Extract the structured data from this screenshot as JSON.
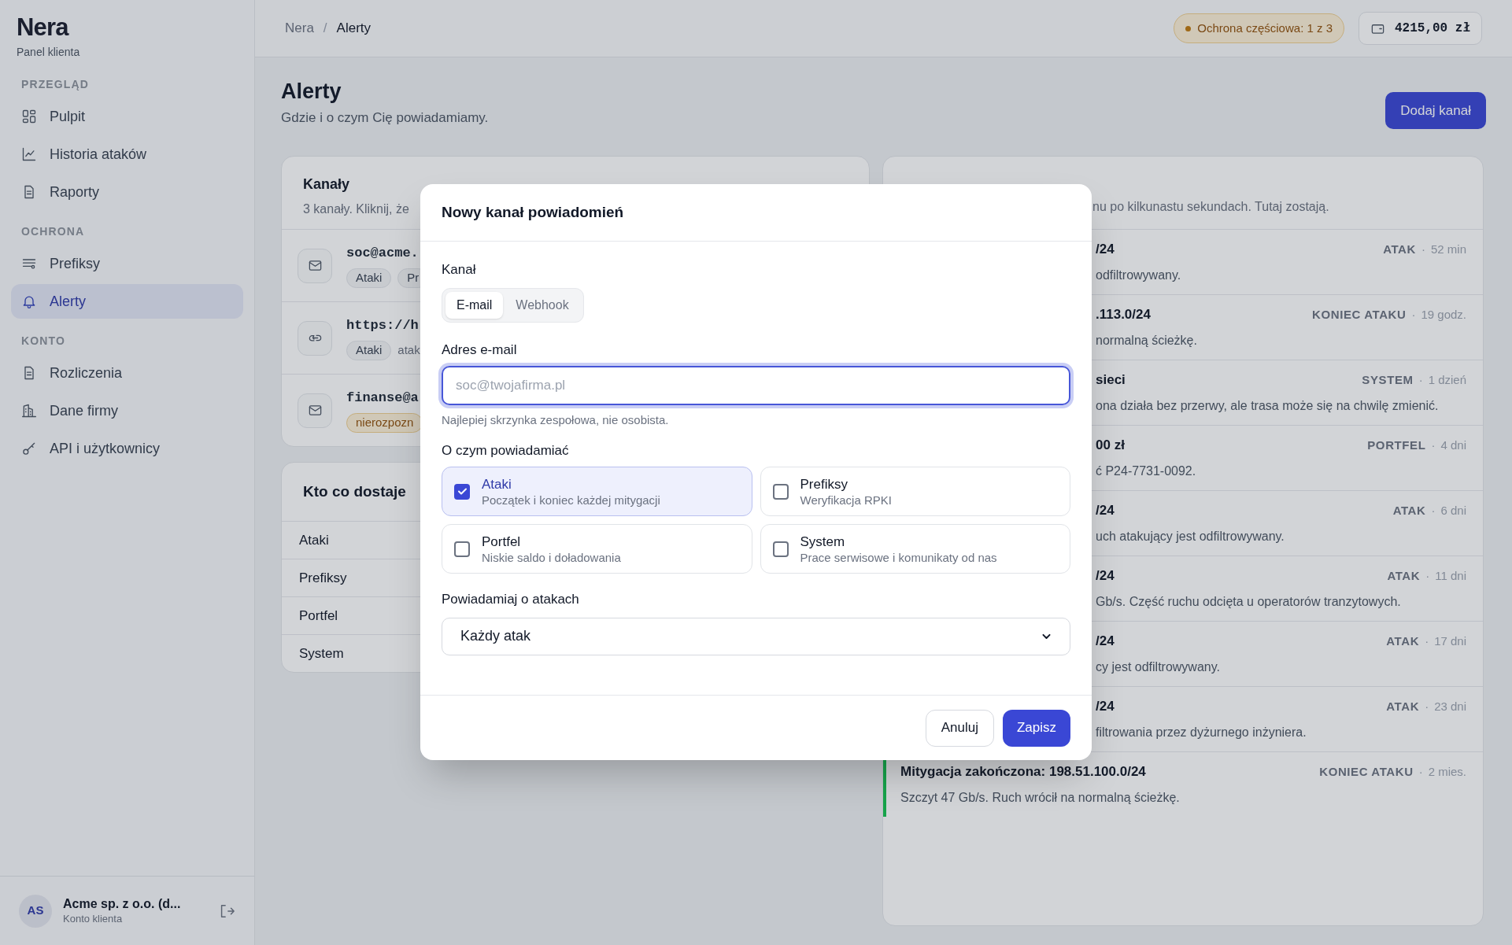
{
  "sidebar": {
    "logo": "Nera",
    "subtitle": "Panel klienta",
    "sections": [
      {
        "heading": "PRZEGLĄD",
        "items": [
          {
            "label": "Pulpit",
            "selected": false
          },
          {
            "label": "Historia ataków",
            "selected": false
          },
          {
            "label": "Raporty",
            "selected": false
          }
        ]
      },
      {
        "heading": "OCHRONA",
        "items": [
          {
            "label": "Prefiksy",
            "selected": false
          },
          {
            "label": "Alerty",
            "selected": true
          }
        ]
      },
      {
        "heading": "KONTO",
        "items": [
          {
            "label": "Rozliczenia",
            "selected": false
          },
          {
            "label": "Dane firmy",
            "selected": false
          },
          {
            "label": "API i użytkownicy",
            "selected": false
          }
        ]
      }
    ],
    "account": {
      "initials": "AS",
      "name": "Acme sp. z o.o. (d...",
      "role": "Konto klienta"
    }
  },
  "header": {
    "breadcrumb": [
      "Nera",
      "Alerty"
    ],
    "separator": "/",
    "protection_badge": "Ochrona częściowa: 1 z 3",
    "balance": "4215,00 zł"
  },
  "page": {
    "title": "Alerty",
    "subtitle": "Gdzie i o czym Cię powiadamiamy.",
    "add_button": "Dodaj kanał"
  },
  "channels_panel": {
    "title": "Kanały",
    "description": "3 kanały. Kliknij, że",
    "channels": [
      {
        "kind": "email",
        "address": "soc@acme.",
        "tags": [
          {
            "label": "Ataki",
            "kind": "normal"
          },
          {
            "label": "Pr",
            "kind": "normal"
          }
        ]
      },
      {
        "kind": "webhook",
        "address": "https://h",
        "tags": [
          {
            "label": "Ataki",
            "kind": "normal"
          }
        ],
        "note": "atak"
      },
      {
        "kind": "email",
        "address": "finanse@a",
        "tags": [
          {
            "label": "nierozpozn",
            "kind": "warning"
          }
        ]
      }
    ]
  },
  "routing_panel": {
    "title": "Kto co dostaje",
    "rows": [
      "Ataki",
      "Prefiksy",
      "Portfel",
      "System"
    ]
  },
  "sent_panel": {
    "description": "nu po kilkunastu sekundach. Tutaj zostają.",
    "items": [
      {
        "title": "/24",
        "body": "odfiltrowywany.",
        "type": "ATAK",
        "separator": "·",
        "age": "52 min"
      },
      {
        "title": ".113.0/24",
        "body": "normalną ścieżkę.",
        "type": "KONIEC ATAKU",
        "separator": "·",
        "age": "19 godz."
      },
      {
        "title": "sieci",
        "body": "ona działa bez przerwy, ale trasa może się na chwilę zmienić.",
        "type": "SYSTEM",
        "separator": "·",
        "age": "1 dzień"
      },
      {
        "title": "00 zł",
        "body": "ć P24-7731-0092.",
        "type": "PORTFEL",
        "separator": "·",
        "age": "4 dni"
      },
      {
        "title": "/24",
        "body": "uch atakujący jest odfiltrowywany.",
        "type": "ATAK",
        "separator": "·",
        "age": "6 dni"
      },
      {
        "title": "/24",
        "body": "Gb/s. Część ruchu odcięta u operatorów tranzytowych.",
        "type": "ATAK",
        "separator": "·",
        "age": "11 dni"
      },
      {
        "title": "/24",
        "body": "cy jest odfiltrowywany.",
        "type": "ATAK",
        "separator": "·",
        "age": "17 dni"
      },
      {
        "title": "/24",
        "body": "filtrowania przez dyżurnego inżyniera.",
        "type": "ATAK",
        "separator": "·",
        "age": "23 dni"
      },
      {
        "title": "Mitygacja zakończona: 198.51.100.0/24",
        "body": "Szczyt 47 Gb/s. Ruch wrócił na normalną ścieżkę.",
        "type": "KONIEC ATAKU",
        "separator": "·",
        "age": "2 mies.",
        "color": "#16a34a"
      }
    ]
  },
  "modal": {
    "title": "Nowy kanał powiadomień",
    "channel_label": "Kanał",
    "channel_tabs": [
      {
        "label": "E-mail",
        "selected": true
      },
      {
        "label": "Webhook",
        "selected": false
      }
    ],
    "email_label": "Adres e-mail",
    "email_placeholder": "soc@twojafirma.pl",
    "email_hint": "Najlepiej skrzynka zespołowa, nie osobista.",
    "topics_label": "O czym powiadamiać",
    "topics": [
      {
        "name": "Ataki",
        "description": "Początek i koniec każdej mitygacji",
        "checked": true
      },
      {
        "name": "Prefiksy",
        "description": "Weryfikacja RPKI",
        "checked": false
      },
      {
        "name": "Portfel",
        "description": "Niskie saldo i doładowania",
        "checked": false
      },
      {
        "name": "System",
        "description": "Prace serwisowe i komunikaty od nas",
        "checked": false
      }
    ],
    "attack_label": "Powiadamiaj o atakach",
    "attack_select": "Każdy atak",
    "buttons": {
      "cancel": "Anuluj",
      "save": "Zapisz"
    }
  }
}
